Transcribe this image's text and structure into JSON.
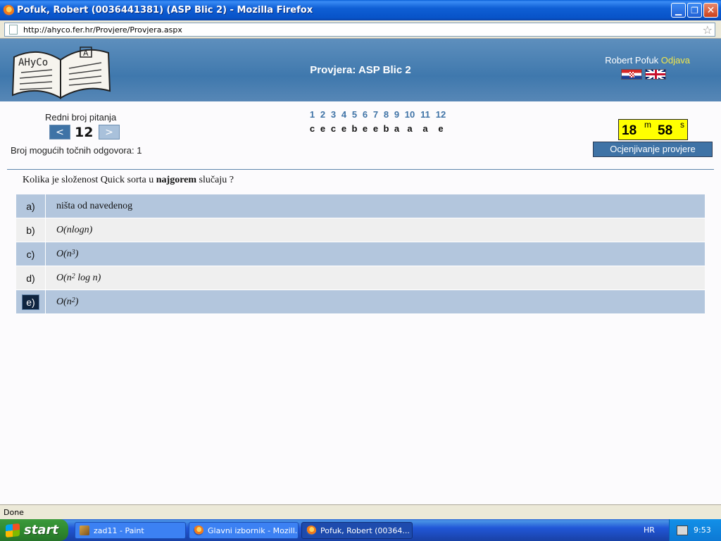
{
  "window": {
    "title": "Pofuk, Robert (0036441381) (ASP Blic 2) - Mozilla Firefox",
    "minimize": "▁",
    "restore": "❐",
    "close": "✕"
  },
  "address": {
    "url": "http://ahyco.fer.hr/Provjere/Provjera.aspx"
  },
  "header": {
    "logo_text": "AHyCo",
    "logo_letter": "A",
    "title": "Provjera: ASP Blic 2",
    "user_name": "Robert Pofuk",
    "logout": "Odjava"
  },
  "question_nav": {
    "label": "Redni broj pitanja",
    "prev": "<",
    "next": ">",
    "current": "12",
    "answers_count_label": "Broj mogućih točnih odgovora: 1",
    "numbers": [
      "1",
      "2",
      "3",
      "4",
      "5",
      "6",
      "7",
      "8",
      "9",
      "10",
      "11",
      "12"
    ],
    "answers": [
      "c",
      "e",
      "c",
      "e",
      "b",
      "e",
      "e",
      "b",
      "a",
      "a",
      "a",
      "e"
    ]
  },
  "timer": {
    "minutes": "18",
    "minutes_unit": "m",
    "seconds": "58",
    "seconds_unit": "s"
  },
  "grade_button": "Ocjenjivanje provjere",
  "question": {
    "text_before": "Kolika je složenost Quick sorta u ",
    "text_bold": "najgorem",
    "text_after": " slučaju ?"
  },
  "options": [
    {
      "letter": "a)",
      "text": "ništa od navedenog",
      "selected": false
    },
    {
      "letter": "b)",
      "text": "O(n log n)",
      "selected": false
    },
    {
      "letter": "c)",
      "text": "O(n3)",
      "selected": false
    },
    {
      "letter": "d)",
      "text": "O(n2 log n)",
      "selected": false
    },
    {
      "letter": "e)",
      "text": "O(n2)",
      "selected": true
    }
  ],
  "status": "Done",
  "taskbar": {
    "start": "start",
    "tasks": [
      "zad11 - Paint",
      "Glavni izbornik - Mozill...",
      "Pofuk, Robert (00364..."
    ],
    "language": "HR",
    "clock": "9:53"
  },
  "colors": {
    "header_blue": "#3f78ad",
    "accent_blue": "#3f73a6",
    "timer_yellow": "#ffff00",
    "logout_yellow": "#f3e84a",
    "row_dark": "#b3c6dd",
    "row_light": "#efefef"
  },
  "icons": {
    "browser": "firefox-icon",
    "page": "page-icon",
    "bookmark": "star-icon",
    "flags": [
      "croatia-flag-icon",
      "uk-flag-icon"
    ]
  }
}
